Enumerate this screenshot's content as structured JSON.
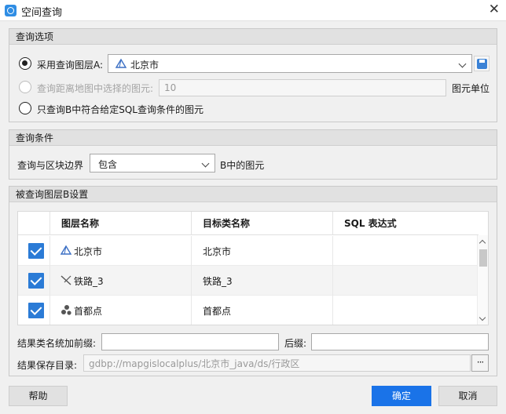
{
  "window": {
    "title": "空间查询",
    "close_glyph": "✕"
  },
  "options": {
    "header": "查询选项",
    "radio_layer_a": "采用查询图层A:",
    "layer_a_value": "北京市",
    "radio_distance": "查询距离地图中选择的图元:",
    "distance_value": "10",
    "distance_unit": "图元单位",
    "radio_sql_only": "只查询B中符合给定SQL查询条件的图元"
  },
  "conditions": {
    "header": "查询条件",
    "label": "查询与区块边界",
    "relation_value": "包含",
    "suffix": "B中的图元"
  },
  "layer_b": {
    "header": "被查询图层B设置",
    "columns": [
      "图层名称",
      "目标类名称",
      "SQL 表达式"
    ],
    "rows": [
      {
        "checked": true,
        "layer": "北京市",
        "target": "北京市",
        "sql": "",
        "icon": "polygon-layer-icon"
      },
      {
        "checked": true,
        "layer": "铁路_3",
        "target": "铁路_3",
        "sql": "",
        "icon": "line-layer-icon"
      },
      {
        "checked": true,
        "layer": "首都点",
        "target": "首都点",
        "sql": "",
        "icon": "point-layer-icon"
      }
    ],
    "prefix_label": "结果类名统加前缀:",
    "prefix_value": "",
    "suffix_label": "后缀:",
    "suffix_value": "",
    "save_label": "结果保存目录:",
    "save_path": "gdbp://mapgislocalplus/北京市_java/ds/行政区",
    "browse_glyph": "···"
  },
  "buttons": {
    "help": "帮助",
    "ok": "确定",
    "cancel": "取消"
  },
  "colors": {
    "accent": "#1a73e8",
    "checkbox": "#2b7bd6"
  }
}
